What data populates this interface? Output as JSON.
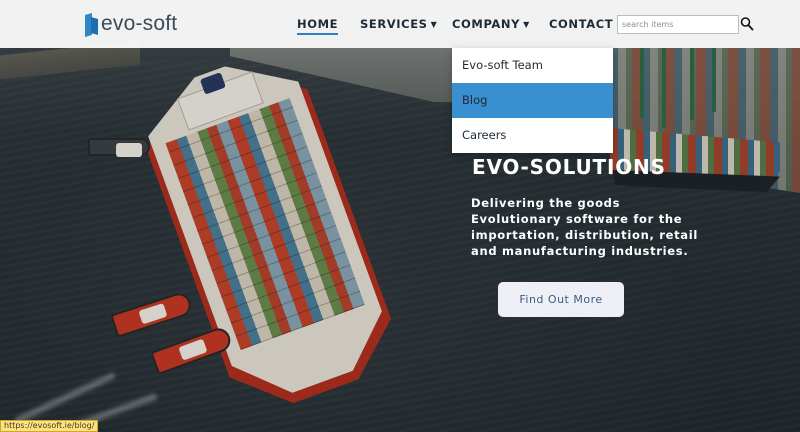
{
  "brand": {
    "logo_text": "evo-soft",
    "accent": "#2d7fbf"
  },
  "nav": {
    "items": [
      {
        "label": "HOME",
        "active": true,
        "has_caret": false
      },
      {
        "label": "SERVICES",
        "active": false,
        "has_caret": true
      },
      {
        "label": "COMPANY",
        "active": false,
        "has_caret": true
      },
      {
        "label": "CONTACT",
        "active": false,
        "has_caret": false
      }
    ],
    "caret_glyph": "▼"
  },
  "search": {
    "placeholder": "search items",
    "value": "",
    "icon": "search-icon"
  },
  "dropdown": {
    "parent": "COMPANY",
    "items": [
      {
        "label": "Evo-soft Team",
        "highlighted": false
      },
      {
        "label": "Blog",
        "highlighted": true
      },
      {
        "label": "Careers",
        "highlighted": false
      }
    ],
    "highlight_color": "#3a8fd0"
  },
  "hero": {
    "title": "EVO-SOLUTIONS",
    "lines": [
      "Delivering the goods",
      "Evolutionary software for the",
      "importation, distribution, retail",
      "and manufacturing industries."
    ],
    "cta_label": "Find Out More"
  },
  "status_bar": {
    "url": "https://evosoft.ie/blog/"
  }
}
